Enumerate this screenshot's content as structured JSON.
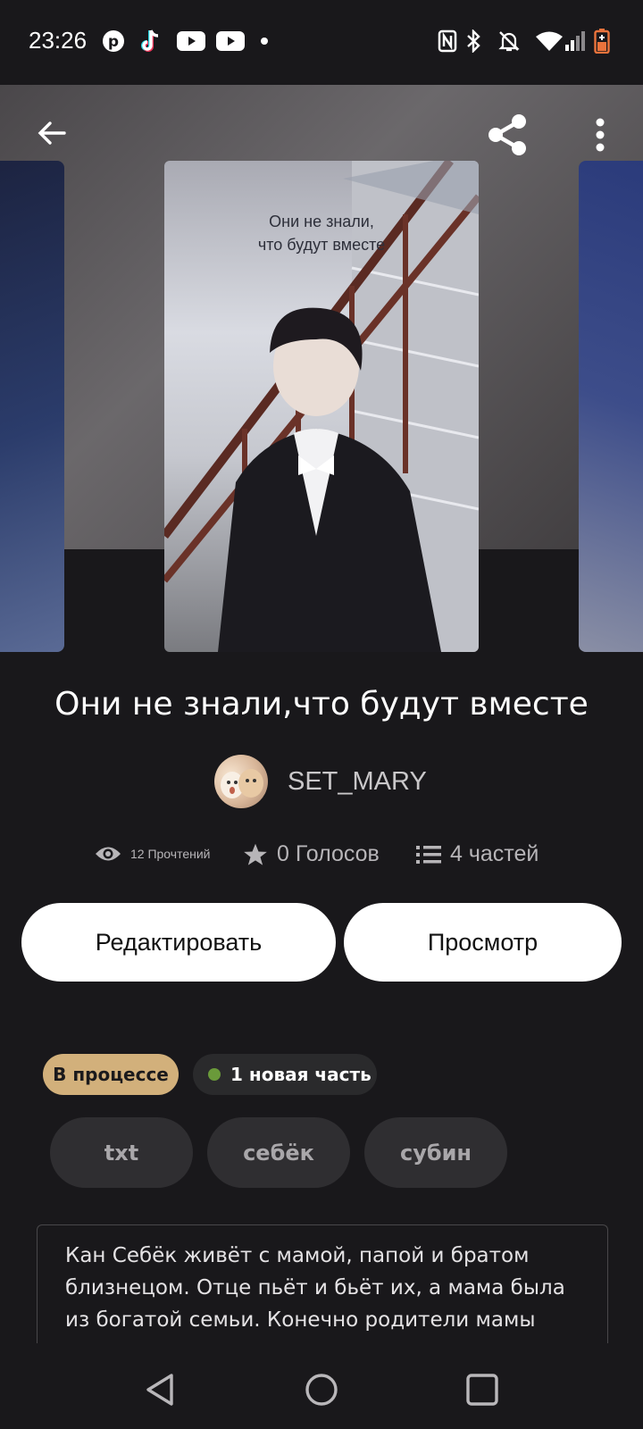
{
  "status_bar": {
    "time": "23:26",
    "left_icons": [
      "pinterest-icon",
      "tiktok-icon",
      "youtube-icon",
      "youtube-icon",
      "dot-icon"
    ],
    "right_icons": [
      "nfc-icon",
      "bluetooth-icon",
      "mute-icon",
      "wifi-icon",
      "signal-icon",
      "battery-icon"
    ]
  },
  "toolbar": {
    "back_icon": "arrow-left-icon",
    "share_icon": "share-icon",
    "menu_icon": "more-vert-icon"
  },
  "cover": {
    "overlay_line1": "Они не знали,",
    "overlay_line2": "что будут вместе"
  },
  "story": {
    "title": "Они не знали,что будут вместе",
    "author": "SET_MARY",
    "reads": "12 Прочтений",
    "votes": "0 Голосов",
    "parts": "4 частей"
  },
  "actions": {
    "edit_label": "Редактировать",
    "preview_label": "Просмотр"
  },
  "badges": {
    "status": "В процессе",
    "new_part": "1 новая часть"
  },
  "tags": [
    "txt",
    "себёк",
    "субин"
  ],
  "description": "Кан Себёк живёт с мамой, папой и братом близнецом. Отце пьёт и бьёт их, а мама была из богатой семьи. Конечно родители мамы",
  "colors": {
    "background": "#19181b",
    "status_badge": "#d2b07b",
    "new_part_dot": "#6a9a3a",
    "battery_accent": "#e9733c"
  }
}
